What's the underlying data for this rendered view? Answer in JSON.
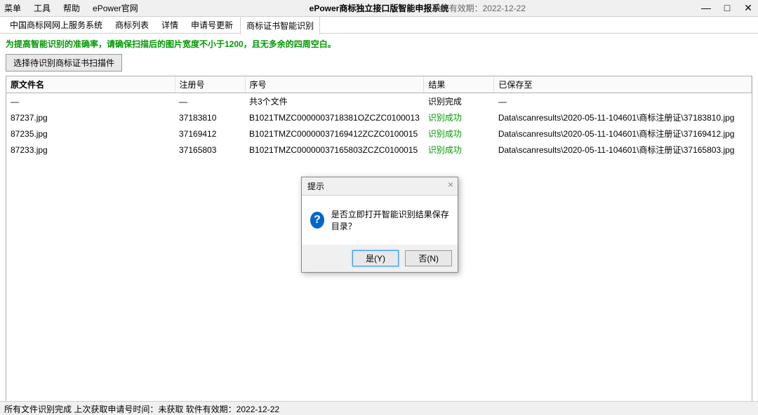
{
  "menu": {
    "items": [
      "菜单",
      "工具",
      "帮助",
      "ePower官网"
    ]
  },
  "title": "ePower商标独立接口版智能申报系统",
  "expiry_label": "软件有效期：",
  "expiry_date": "2022-12-22",
  "window_buttons": {
    "min": "—",
    "max": "□",
    "close": "✕"
  },
  "tabs": [
    "中国商标网网上服务系统",
    "商标列表",
    "详情",
    "申请号更新",
    "商标证书智能识别"
  ],
  "active_tab": 4,
  "hint": "为提高智能识别的准确率，请确保扫描后的图片宽度不小于1200，且无多余的四周空白。",
  "select_button": "选择待识别商标证书扫描件",
  "table": {
    "headers": [
      "原文件名",
      "注册号",
      "序号",
      "结果",
      "已保存至"
    ],
    "summary": [
      "—",
      "—",
      "共3个文件",
      "识别完成",
      "—"
    ],
    "rows": [
      {
        "file": "87237.jpg",
        "reg": "37183810",
        "seq": "B1021TMZC0000003718381OZCZC0100013",
        "result": "识别成功",
        "save": "Data\\scanresults\\2020-05-11-104601\\商标注册证\\37183810.jpg"
      },
      {
        "file": "87235.jpg",
        "reg": "37169412",
        "seq": "B1021TMZC00000037169412ZCZC0100015",
        "result": "识别成功",
        "save": "Data\\scanresults\\2020-05-11-104601\\商标注册证\\37169412.jpg"
      },
      {
        "file": "87233.jpg",
        "reg": "37165803",
        "seq": "B1021TMZC00000037165803ZCZC0100015",
        "result": "识别成功",
        "save": "Data\\scanresults\\2020-05-11-104601\\商标注册证\\37165803.jpg"
      }
    ]
  },
  "dialog": {
    "title": "提示",
    "message": "是否立即打开智能识别结果保存目录？",
    "yes": "是(Y)",
    "no": "否(N)"
  },
  "statusbar": "所有文件识别完成   上次获取申请号时间：未获取   软件有效期：2022-12-22"
}
